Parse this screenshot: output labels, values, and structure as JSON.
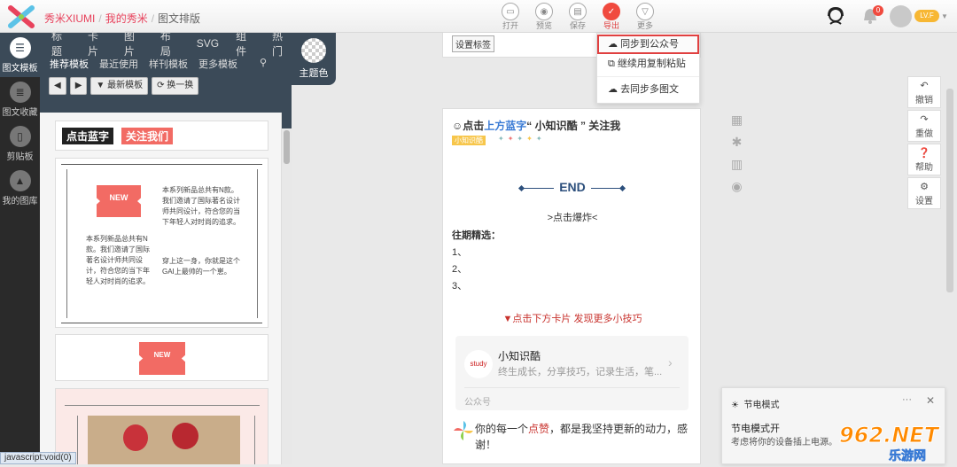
{
  "breadcrumb": {
    "brand": "秀米XIUMI",
    "sep": "/",
    "mine": "我的秀米",
    "current": "图文排版"
  },
  "toolbar": [
    {
      "label": "打开",
      "icon": "folder-icon"
    },
    {
      "label": "预览",
      "icon": "eye-icon"
    },
    {
      "label": "保存",
      "icon": "save-icon"
    },
    {
      "label": "导出",
      "icon": "check-icon",
      "active": true
    },
    {
      "label": "更多",
      "icon": "chevron-down-icon"
    }
  ],
  "notification_count": "0",
  "level": "LV.F",
  "leftnav": [
    {
      "label": "图文模板",
      "active": true
    },
    {
      "label": "图文收藏"
    },
    {
      "label": "剪贴板"
    },
    {
      "label": "我的图库"
    }
  ],
  "category_tabs": [
    "标题",
    "卡片",
    "图片",
    "布局",
    "SVG",
    "组件",
    "热门"
  ],
  "sub_tabs": [
    "推荐模板",
    "最近使用",
    "样刊模板",
    "更多模板"
  ],
  "buttons": {
    "back": "◀",
    "forward": "▶",
    "latest": "最新模板",
    "swap": "换一换"
  },
  "theme_label": "主题色",
  "templates": {
    "t1_left": "点击蓝字",
    "t1_right": "关注我们",
    "new_badge": "NEW",
    "t2_text": "本系列新品总共有N款。我们邀请了国际著名设计师共同设计，符合您的当下年轻人对时尚的追求。",
    "t2_text2": "穿上这一身，你就是这个GAI上最帅的一个崽。",
    "t3_badge": "NEW"
  },
  "settag_label": "设置标签",
  "export_menu": [
    "同步到公众号",
    "继续用复制粘贴",
    "去同步多图文"
  ],
  "editor": {
    "head_prefix": "点击",
    "head_blue": "上方蓝字",
    "head_suffix": "“ 小知识酷 ” 关注我",
    "tag": "小知识酷",
    "end": "END",
    "burst": ">点击爆炸<",
    "past": "往期精选：",
    "list": [
      "1、",
      "2、",
      "3、"
    ],
    "red": "▼点击下方卡片 发现更多小技巧",
    "card_title": "小知识酷",
    "card_desc": "终生成长，分享技巧，记录生活，笔...",
    "card_type": "公众号",
    "logo_text": "study",
    "footer_a": "你的每一个",
    "footer_red": "点赞",
    "footer_b": "，都是我坚持更新的动力，感谢！"
  },
  "side_buttons": [
    {
      "label": "撤销",
      "icon": "undo-icon"
    },
    {
      "label": "重做",
      "icon": "redo-icon"
    },
    {
      "label": "帮助",
      "icon": "help-icon"
    },
    {
      "label": "设置",
      "icon": "gear-icon"
    }
  ],
  "toast": {
    "title": "节电模式",
    "heading": "节电模式开",
    "body": "考虑将你的设备插上电源。"
  },
  "watermark": "962.NET 乐游网",
  "status": "javascript:void(0)"
}
